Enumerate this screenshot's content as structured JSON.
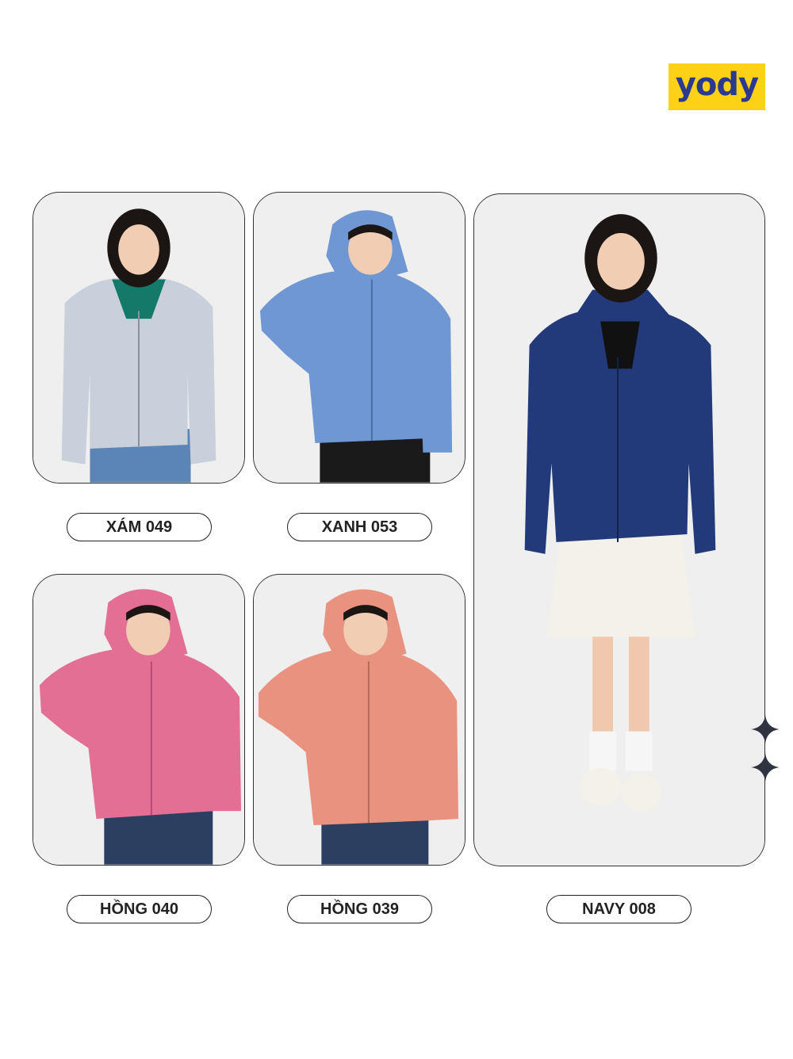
{
  "brand": {
    "logo_text": "yody",
    "logo_bg": "#fcd116",
    "logo_fg": "#2b3a8f"
  },
  "products": [
    {
      "label": "XÁM 049",
      "jacket_color": "#c9d0db",
      "shirt_color": "#137a6a",
      "bottom_color": "#5b84b7",
      "pose": "standing-front"
    },
    {
      "label": "XANH 053",
      "jacket_color": "#6f97d3",
      "shirt_color": "#6f97d3",
      "bottom_color": "#1a1a1a",
      "pose": "hood-up"
    },
    {
      "label": "HỒNG 040",
      "jacket_color": "#e46f95",
      "shirt_color": "#e46f95",
      "bottom_color": "#2c3f60",
      "pose": "hood-up"
    },
    {
      "label": "HỒNG 039",
      "jacket_color": "#e9927f",
      "shirt_color": "#e9927f",
      "bottom_color": "#2c3f60",
      "pose": "hood-up"
    },
    {
      "label": "NAVY 008",
      "jacket_color": "#233a7a",
      "shirt_color": "#111111",
      "bottom_color": "#f3f1ea",
      "pose": "full-body"
    }
  ],
  "decorations": {
    "sparkle_icon": "four-point-star-icon"
  }
}
